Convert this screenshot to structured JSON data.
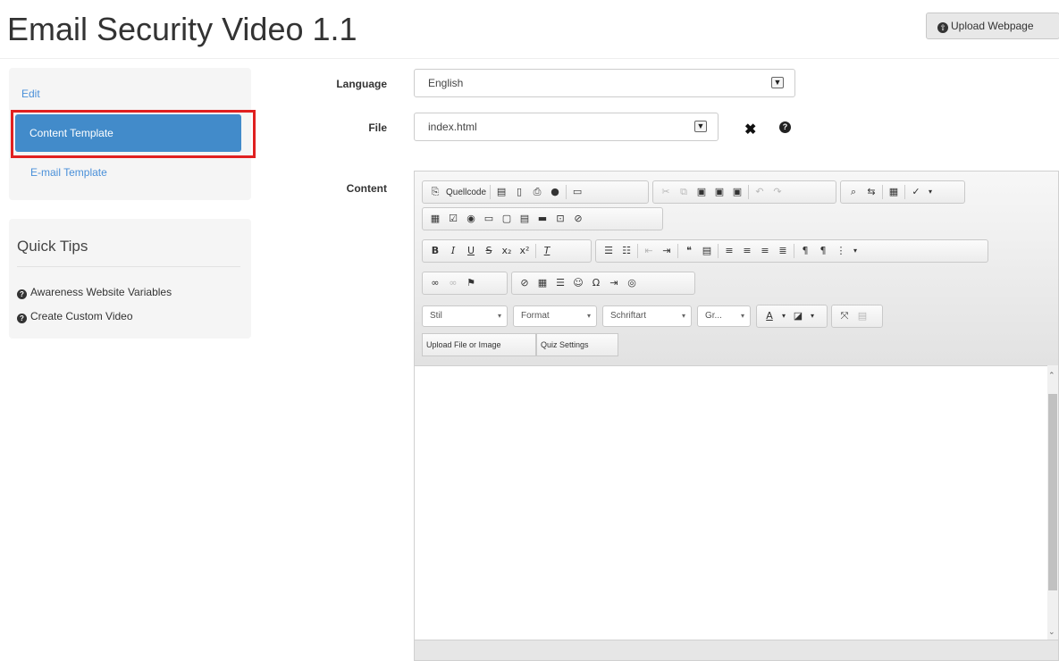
{
  "page": {
    "title": "Email Security Video 1.1",
    "upload_webpage_label": "Upload Webpage"
  },
  "sidebar": {
    "items": [
      {
        "label": "Edit"
      },
      {
        "label": "Content Template",
        "active": true
      },
      {
        "label": "E-mail Template"
      }
    ]
  },
  "quick_tips": {
    "title": "Quick Tips",
    "items": [
      {
        "label": "Awareness Website Variables",
        "icon": "question-circle-icon"
      },
      {
        "label": "Create Custom Video",
        "icon": "question-circle-icon"
      }
    ]
  },
  "form": {
    "language_label": "Language",
    "language_value": "English",
    "file_label": "File",
    "file_value": "index.html",
    "content_label": "Content"
  },
  "editor": {
    "source_label": "Quellcode",
    "style_combo": "Stil",
    "format_combo": "Format",
    "font_combo": "Schriftart",
    "size_combo": "Gr...",
    "upload_file_label": "Upload File or Image",
    "quiz_settings_label": "Quiz Settings",
    "content_text": ""
  },
  "colors": {
    "accent": "#428bca",
    "highlight_border": "#e02020",
    "link": "#4a90d9"
  }
}
